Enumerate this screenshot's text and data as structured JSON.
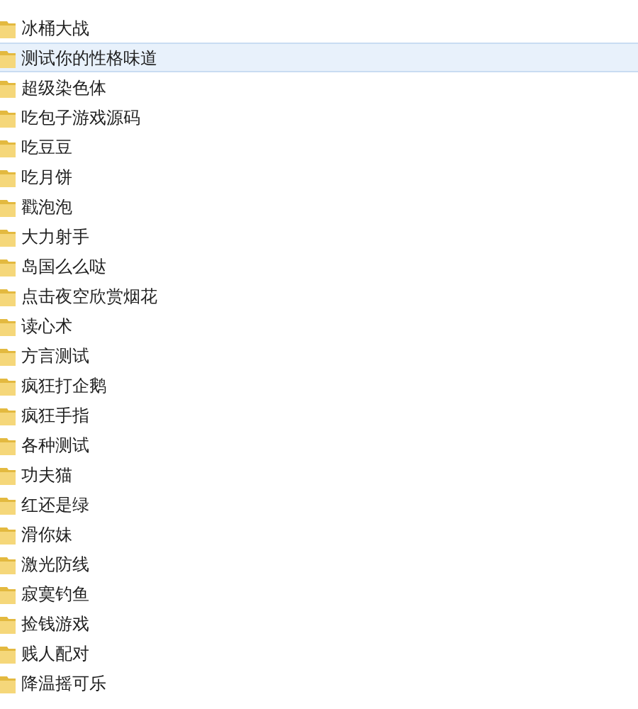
{
  "files": [
    {
      "name": "冰桶大战",
      "selected": false
    },
    {
      "name": "测试你的性格味道",
      "selected": true
    },
    {
      "name": "超级染色体",
      "selected": false
    },
    {
      "name": "吃包子游戏源码",
      "selected": false
    },
    {
      "name": "吃豆豆",
      "selected": false
    },
    {
      "name": "吃月饼",
      "selected": false
    },
    {
      "name": "戳泡泡",
      "selected": false
    },
    {
      "name": "大力射手",
      "selected": false
    },
    {
      "name": "岛国么么哒",
      "selected": false
    },
    {
      "name": "点击夜空欣赏烟花",
      "selected": false
    },
    {
      "name": "读心术",
      "selected": false
    },
    {
      "name": "方言测试",
      "selected": false
    },
    {
      "name": "疯狂打企鹅",
      "selected": false
    },
    {
      "name": "疯狂手指",
      "selected": false
    },
    {
      "name": "各种测试",
      "selected": false
    },
    {
      "name": "功夫猫",
      "selected": false
    },
    {
      "name": "红还是绿",
      "selected": false
    },
    {
      "name": "滑你妹",
      "selected": false
    },
    {
      "name": "激光防线",
      "selected": false
    },
    {
      "name": "寂寞钓鱼",
      "selected": false
    },
    {
      "name": "捡钱游戏",
      "selected": false
    },
    {
      "name": "贱人配对",
      "selected": false
    },
    {
      "name": "降温摇可乐",
      "selected": false
    }
  ]
}
